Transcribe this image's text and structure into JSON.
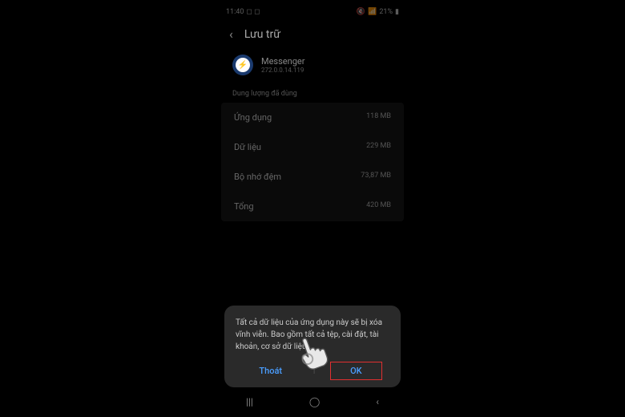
{
  "status": {
    "time": "11:40",
    "battery": "21%"
  },
  "header": {
    "title": "Lưu trữ"
  },
  "app": {
    "name": "Messenger",
    "version": "272.0.0.14.119"
  },
  "section_label": "Dung lượng đã dùng",
  "storage": [
    {
      "label": "Ứng dụng",
      "value": "118 MB"
    },
    {
      "label": "Dữ liệu",
      "value": "229 MB"
    },
    {
      "label": "Bộ nhớ đệm",
      "value": "73,87 MB"
    },
    {
      "label": "Tổng",
      "value": "420 MB"
    }
  ],
  "dialog": {
    "message": "Tất cả dữ liệu của ứng dụng này sẽ bị xóa vĩnh viễn. Bao gồm tất cả tệp, cài đặt, tài khoản, cơ sở dữ liệu,...",
    "cancel": "Thoát",
    "ok": "OK"
  }
}
